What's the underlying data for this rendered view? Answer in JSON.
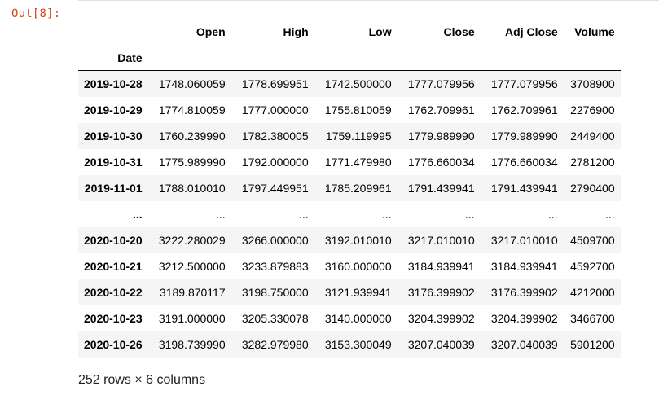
{
  "cell": {
    "prompt": "Out[8]:"
  },
  "dataframe": {
    "index_name": "Date",
    "columns": [
      "Open",
      "High",
      "Low",
      "Close",
      "Adj Close",
      "Volume"
    ],
    "rows": [
      {
        "index": "2019-10-28",
        "values": [
          "1748.060059",
          "1778.699951",
          "1742.500000",
          "1777.079956",
          "1777.079956",
          "3708900"
        ]
      },
      {
        "index": "2019-10-29",
        "values": [
          "1774.810059",
          "1777.000000",
          "1755.810059",
          "1762.709961",
          "1762.709961",
          "2276900"
        ]
      },
      {
        "index": "2019-10-30",
        "values": [
          "1760.239990",
          "1782.380005",
          "1759.119995",
          "1779.989990",
          "1779.989990",
          "2449400"
        ]
      },
      {
        "index": "2019-10-31",
        "values": [
          "1775.989990",
          "1792.000000",
          "1771.479980",
          "1776.660034",
          "1776.660034",
          "2781200"
        ]
      },
      {
        "index": "2019-11-01",
        "values": [
          "1788.010010",
          "1797.449951",
          "1785.209961",
          "1791.439941",
          "1791.439941",
          "2790400"
        ]
      },
      {
        "index": "...",
        "values": [
          "...",
          "...",
          "...",
          "...",
          "...",
          "..."
        ]
      },
      {
        "index": "2020-10-20",
        "values": [
          "3222.280029",
          "3266.000000",
          "3192.010010",
          "3217.010010",
          "3217.010010",
          "4509700"
        ]
      },
      {
        "index": "2020-10-21",
        "values": [
          "3212.500000",
          "3233.879883",
          "3160.000000",
          "3184.939941",
          "3184.939941",
          "4592700"
        ]
      },
      {
        "index": "2020-10-22",
        "values": [
          "3189.870117",
          "3198.750000",
          "3121.939941",
          "3176.399902",
          "3176.399902",
          "4212000"
        ]
      },
      {
        "index": "2020-10-23",
        "values": [
          "3191.000000",
          "3205.330078",
          "3140.000000",
          "3204.399902",
          "3204.399902",
          "3466700"
        ]
      },
      {
        "index": "2020-10-26",
        "values": [
          "3198.739990",
          "3282.979980",
          "3153.300049",
          "3207.040039",
          "3207.040039",
          "5901200"
        ]
      }
    ],
    "summary": "252 rows × 6 columns"
  }
}
